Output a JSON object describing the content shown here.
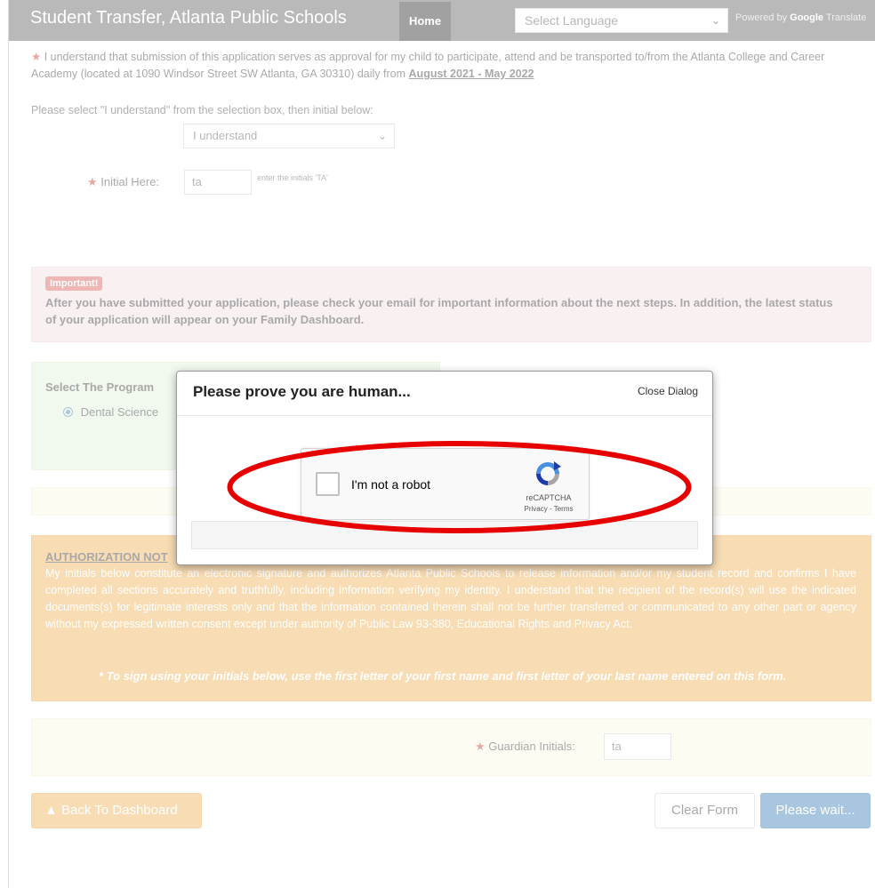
{
  "header": {
    "title": "Student Transfer, Atlanta Public Schools",
    "home_tab": "Home",
    "language_select": "Select Language",
    "powered_by": "Powered by",
    "google": "Google",
    "translate": "Translate"
  },
  "agreement": {
    "text": "I understand that submission of this application serves as approval for my child to participate, attend and be transported to/from the Atlanta College and Career Academy (located at 1090 Windsor Street SW Atlanta, GA 30310) daily from",
    "dates": "August 2021 - May 2022",
    "select_prompt": "Please select \"I understand\" from the selection box, then initial below:",
    "select_value": "I understand",
    "initial_label": "Initial Here:",
    "initial_value": "ta",
    "initial_hint": "enter the initials 'TA'"
  },
  "important": {
    "badge": "Important!",
    "text": "After you have submitted your application, please check your email for important information about the next steps. In addition, the latest status of your application will appear on your Family Dashboard."
  },
  "program": {
    "title": "Select The Program",
    "option": "Dental Science"
  },
  "authorization": {
    "title": "AUTHORIZATION NOT",
    "text": "My initials below constitute an electronic signature and authorizes Atlanta Public Schools to release information and/or my student record and confirms I have completed all sections accurately and truthfully, including information verifying my identity. I understand that the recipient of the record(s) will use the indicated documents(s) for legitimate interests only and that the information contained therein shall not be further transferred or communicated to any other part or agency without my expressed written consent except under authority of Public Law 93-380, Educational Rights and Privacy Act.",
    "note": "* To sign using your initials below, use the first letter of your first name and first letter of your last name entered on this form."
  },
  "guardian": {
    "label": "Guardian Initials:",
    "value": "ta"
  },
  "buttons": {
    "back": "Back To Dashboard",
    "clear": "Clear Form",
    "submit": "Please wait..."
  },
  "modal": {
    "title": "Please prove you are human...",
    "close": "Close Dialog",
    "recaptcha_label": "I'm not a robot",
    "recaptcha_brand": "reCAPTCHA",
    "recaptcha_links": "Privacy - Terms"
  },
  "colors": {
    "annotation": "#e60000",
    "accent": "#337ab7"
  }
}
